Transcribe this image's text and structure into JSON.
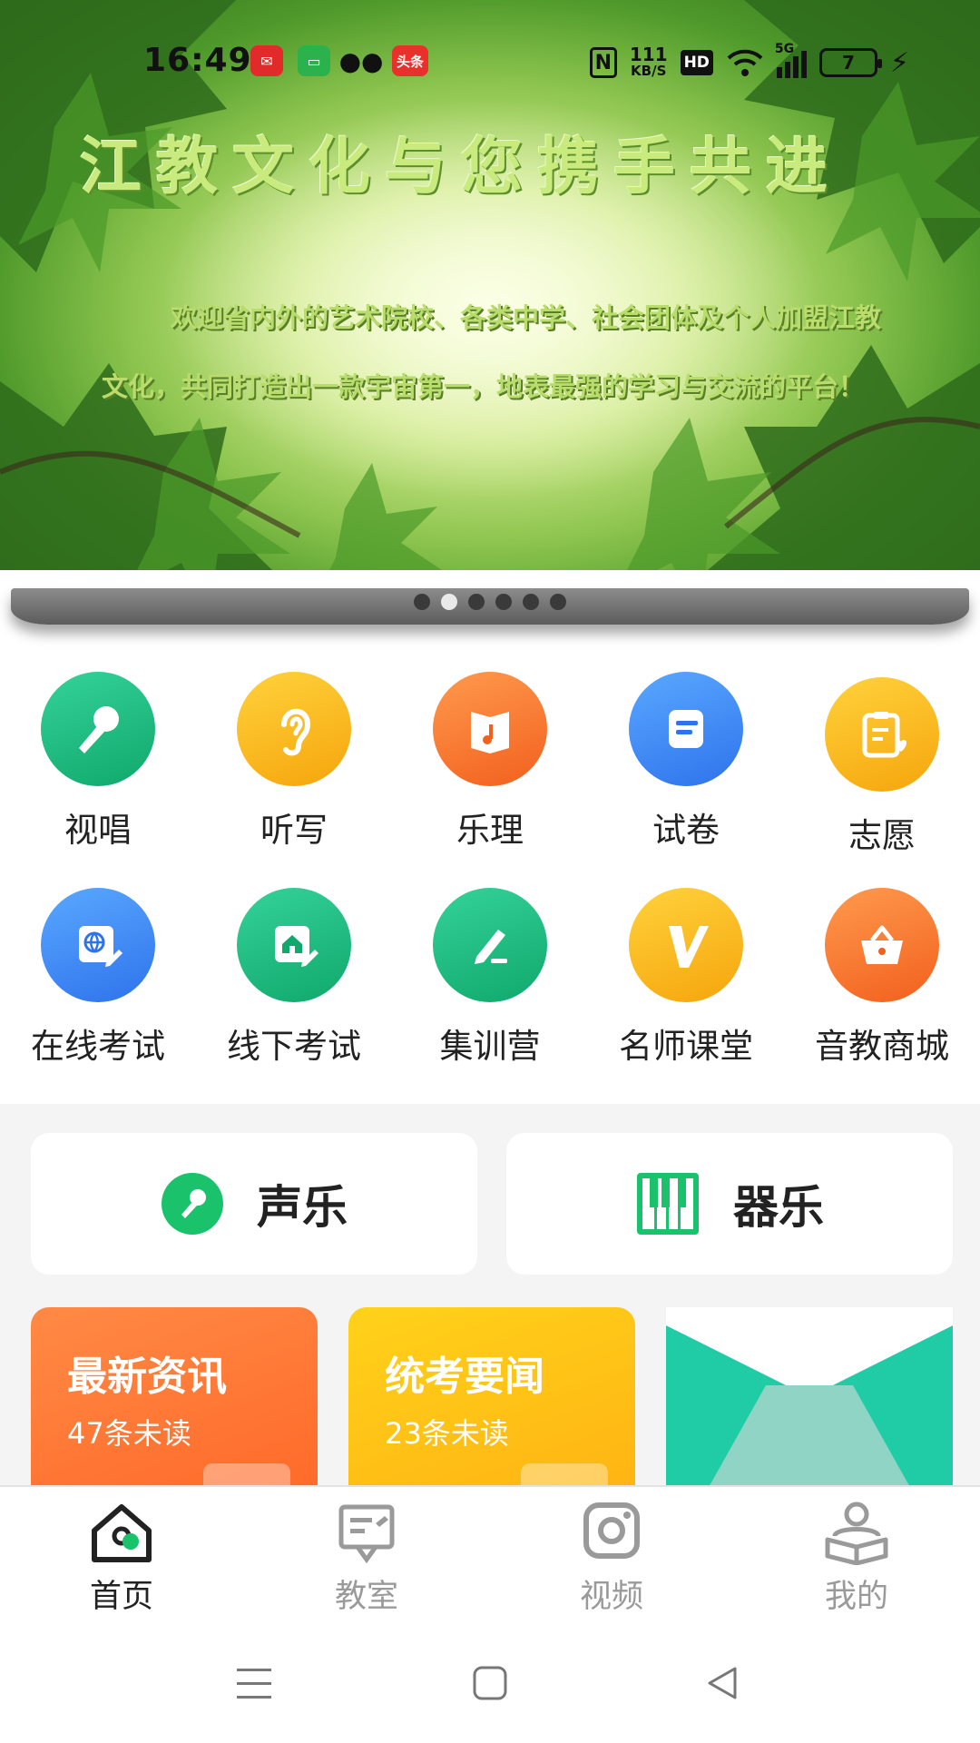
{
  "status_bar": {
    "time": "16:49",
    "apps": [
      "kuaidi-icon",
      "message-icon",
      "wechat-icon",
      "toutiao-icon"
    ],
    "toutiao_label": "头条",
    "nfc": "N",
    "speed_value": "111",
    "speed_unit": "KB/S",
    "hd": "HD",
    "network": "5G",
    "battery": "7"
  },
  "banner": {
    "slogan": "江教文化与您携手共进",
    "welcome": "欢迎省内外的艺术院校、各类中学、社会团体及个人加盟江教文化，共同打造出一款宇宙第一，地表最强的学习与交流的平台！",
    "dots_total": 6,
    "active_dot": 1
  },
  "grid": [
    {
      "label": "视唱",
      "icon": "microphone-icon",
      "color": "green"
    },
    {
      "label": "听写",
      "icon": "ear-icon",
      "color": "yellow"
    },
    {
      "label": "乐理",
      "icon": "music-book-icon",
      "color": "orange"
    },
    {
      "label": "试卷",
      "icon": "scroll-icon",
      "color": "blue"
    },
    {
      "label": "志愿",
      "icon": "clipboard-heart-icon",
      "color": "yellow"
    },
    {
      "label": "在线考试",
      "icon": "globe-edit-icon",
      "color": "blue"
    },
    {
      "label": "线下考试",
      "icon": "house-edit-icon",
      "color": "green"
    },
    {
      "label": "集训营",
      "icon": "pen-icon",
      "color": "green"
    },
    {
      "label": "名师课堂",
      "icon": "v-logo-icon",
      "color": "yellow"
    },
    {
      "label": "音教商城",
      "icon": "basket-icon",
      "color": "orange"
    }
  ],
  "categories": {
    "vocal": {
      "label": "声乐",
      "icon": "microphone-icon"
    },
    "instrumental": {
      "label": "器乐",
      "icon": "piano-icon"
    }
  },
  "news": [
    {
      "title": "最新资讯",
      "sub": "47条未读",
      "color": "#ff7a3d"
    },
    {
      "title": "统考要闻",
      "sub": "23条未读",
      "color": "#ffbe16"
    }
  ],
  "tabs": [
    {
      "label": "首页",
      "icon": "home-icon",
      "active": true
    },
    {
      "label": "教室",
      "icon": "classroom-icon",
      "active": false
    },
    {
      "label": "视频",
      "icon": "video-icon",
      "active": false
    },
    {
      "label": "我的",
      "icon": "profile-icon",
      "active": false
    }
  ],
  "colors": {
    "accent_green": "#19c26b",
    "text_dark": "#222222",
    "tab_inactive": "#9a9a9a"
  }
}
